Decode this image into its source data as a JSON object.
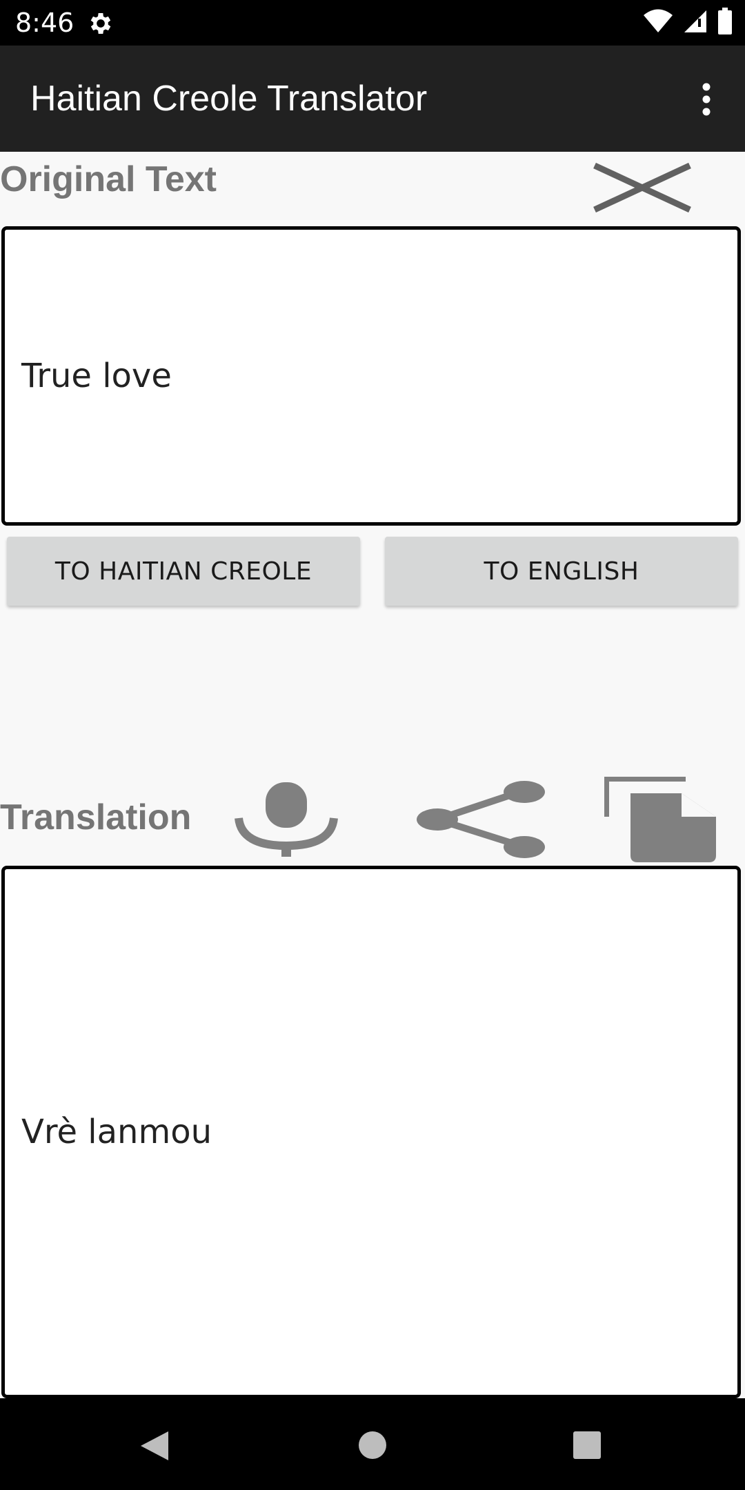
{
  "status_bar": {
    "time": "8:46",
    "icons": [
      "gear-icon",
      "wifi-icon",
      "cell-signal-icon",
      "battery-icon"
    ]
  },
  "app_bar": {
    "title": "Haitian Creole Translator",
    "overflow_icon": "more-vertical-icon"
  },
  "original": {
    "label": "Original Text",
    "text": "True love",
    "clear_icon": "close-icon"
  },
  "buttons": {
    "to_creole": "TO HAITIAN CREOLE",
    "to_english": "TO ENGLISH"
  },
  "translation": {
    "label": "Translation",
    "text": "Vrè lanmou",
    "icons": [
      "microphone-icon",
      "share-icon",
      "copy-icon"
    ]
  },
  "nav_bar": {
    "icons": [
      "back-icon",
      "home-icon",
      "recents-icon"
    ]
  },
  "colors": {
    "app_bar": "#212121",
    "label_gray": "#757575",
    "icon_gray": "#808080",
    "button_bg": "#d6d7d7"
  }
}
